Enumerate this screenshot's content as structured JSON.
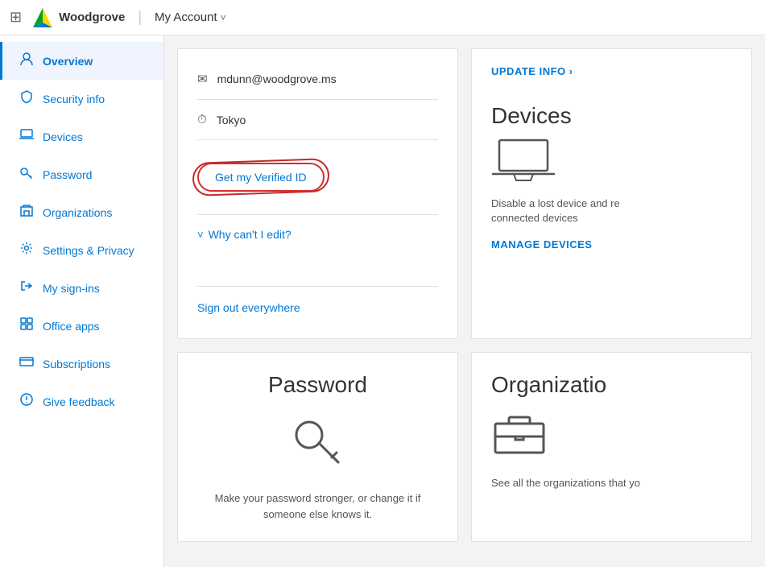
{
  "topbar": {
    "app_name": "Woodgrove",
    "separator": "|",
    "account_label": "My Account",
    "chevron": "˅"
  },
  "sidebar": {
    "items": [
      {
        "id": "overview",
        "label": "Overview",
        "icon": "person",
        "active": true
      },
      {
        "id": "security-info",
        "label": "Security info",
        "icon": "shield"
      },
      {
        "id": "devices",
        "label": "Devices",
        "icon": "laptop"
      },
      {
        "id": "password",
        "label": "Password",
        "icon": "key"
      },
      {
        "id": "organizations",
        "label": "Organizations",
        "icon": "building"
      },
      {
        "id": "settings-privacy",
        "label": "Settings & Privacy",
        "icon": "settings"
      },
      {
        "id": "my-sign-ins",
        "label": "My sign-ins",
        "icon": "signin"
      },
      {
        "id": "office-apps",
        "label": "Office apps",
        "icon": "apps"
      },
      {
        "id": "subscriptions",
        "label": "Subscriptions",
        "icon": "card"
      },
      {
        "id": "give-feedback",
        "label": "Give feedback",
        "icon": "feedback"
      }
    ]
  },
  "profile_card": {
    "email": "mdunn@woodgrove.ms",
    "location": "Tokyo",
    "verified_id_label": "Get my Verified ID",
    "why_edit_label": "Why can't I edit?",
    "sign_out_label": "Sign out everywhere"
  },
  "devices_card": {
    "update_info_label": "UPDATE INFO",
    "update_info_arrow": "›",
    "title": "Devices",
    "description": "Disable a lost device and re connected devices",
    "manage_label": "MANAGE DEVICES"
  },
  "password_card": {
    "title": "Password",
    "description": "Make your password stronger, or change it if someone else knows it."
  },
  "org_card": {
    "title": "Organizatio",
    "description": "See all the organizations that yo"
  }
}
